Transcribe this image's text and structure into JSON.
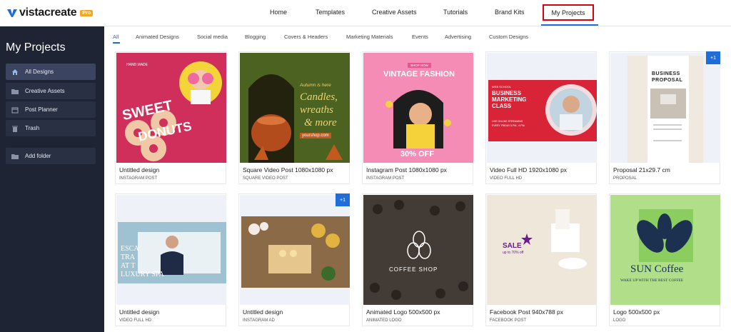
{
  "brand": {
    "name": "vistacreate",
    "badge": "Pro"
  },
  "nav": {
    "home": "Home",
    "templates": "Templates",
    "creative_assets": "Creative Assets",
    "tutorials": "Tutorials",
    "brand_kits": "Brand Kits",
    "my_projects": "My Projects"
  },
  "sidebar": {
    "title": "My Projects",
    "items": [
      {
        "label": "All Designs",
        "icon": "home-icon"
      },
      {
        "label": "Creative Assets",
        "icon": "folder-icon"
      },
      {
        "label": "Post Planner",
        "icon": "calendar-icon"
      },
      {
        "label": "Trash",
        "icon": "trash-icon"
      },
      {
        "label": "Add folder",
        "icon": "add-folder-icon"
      }
    ]
  },
  "filters": [
    "All",
    "Animated Designs",
    "Social media",
    "Blogging",
    "Covers & Headers",
    "Marketing Materials",
    "Events",
    "Advertising",
    "Custom Designs"
  ],
  "cards": [
    {
      "title": "Untitled design",
      "sub": "INSTAGRAM POST",
      "thumb_text": [
        "SWEET",
        "DONUTS"
      ],
      "small_text": "HAND MADE"
    },
    {
      "title": "Square Video Post 1080x1080 px",
      "sub": "SQUARE VIDEO POST",
      "thumb_text": [
        "Autumn is here",
        "Candles,",
        "wreaths",
        "& more",
        "yourshop.com"
      ]
    },
    {
      "title": "Instagram Post 1080x1080 px",
      "sub": "INSTAGRAM POST",
      "thumb_text": [
        "SHOP NOW",
        "VINTAGE FASHION",
        "30% OFF"
      ]
    },
    {
      "title": "Video Full HD 1920x1080 px",
      "sub": "VIDEO FULL HD",
      "thumb_text": [
        "WEB SCHOOL",
        "BUSINESS",
        "MARKETING",
        "CLASS",
        "LIVE ONLINE STREAMING",
        "EVERY FRIDAY 5 PM - 6 PM"
      ]
    },
    {
      "title": "Proposal 21x29.7 cm",
      "sub": "PROPOSAL",
      "badge": "+1",
      "thumb_text": [
        "BUSINESS",
        "PROPOSAL"
      ]
    },
    {
      "title": "Untitled design",
      "sub": "VIDEO FULL HD",
      "thumb_text": [
        "ESCA",
        "TRA",
        "AT T",
        "LUXURY SPA"
      ]
    },
    {
      "title": "Untitled design",
      "sub": "INSTAGRAM AD",
      "badge": "+1"
    },
    {
      "title": "Animated Logo 500x500 px",
      "sub": "ANIMATED LOGO",
      "thumb_text": [
        "COFFEE SHOP"
      ]
    },
    {
      "title": "Facebook Post 940x788 px",
      "sub": "FACEBOOK POST",
      "thumb_text": [
        "SALE",
        "up to 70% off"
      ]
    },
    {
      "title": "Logo 500x500 px",
      "sub": "LOGO",
      "thumb_text": [
        "SUN Coffee",
        "WAKE UP WITH THE BEST COFFEE"
      ]
    }
  ],
  "colors": {
    "accent": "#1e6ddb",
    "sidebar_bg": "#1f2434",
    "highlight": "#d9000d"
  }
}
